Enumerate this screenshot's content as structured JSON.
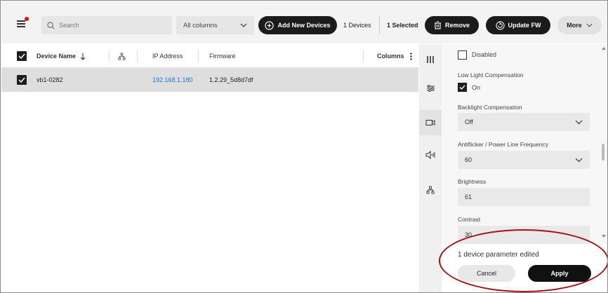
{
  "toolbar": {
    "search_placeholder": "Search",
    "columns_select": "All columns",
    "add_label": "Add New Devices",
    "devices_count": "1 Devices",
    "selected_count": "1 Selected",
    "remove_label": "Remove",
    "update_label": "Update FW",
    "more_label": "More"
  },
  "table": {
    "headers": {
      "device_name": "Device Name",
      "ip_address": "IP Address",
      "firmware": "Firmware",
      "columns": "Columns"
    },
    "rows": [
      {
        "device_name": "vb1-0282",
        "ip_address": "192.168.1.180",
        "firmware": "1.2.29_5d8d7df",
        "selected": true
      }
    ]
  },
  "panel": {
    "disabled_label": "Disabled",
    "low_light_label": "Low Light Compensation",
    "low_light_value": "On",
    "backlight_label": "Backlight Compensation",
    "backlight_value": "Off",
    "antiflicker_label": "Antiflicker / Power Line Frequency",
    "antiflicker_value": "60",
    "brightness_label": "Brightness",
    "brightness_value": "61",
    "contrast_label": "Contrast",
    "contrast_value": "30"
  },
  "footer": {
    "edited_text": "1 device parameter edited",
    "cancel_label": "Cancel",
    "apply_label": "Apply"
  },
  "colors": {
    "link": "#1a73e8",
    "primary": "#111111",
    "highlight": "#a41014",
    "notification": "#dd1111"
  },
  "icons": {
    "menu": "hamburger-icon",
    "search": "search-icon",
    "add": "plus-circle-icon",
    "remove": "trash-icon",
    "update": "refresh-icon",
    "rail": [
      "columns-icon",
      "sliders-icon",
      "camera-icon",
      "speaker-icon",
      "network-icon"
    ]
  }
}
